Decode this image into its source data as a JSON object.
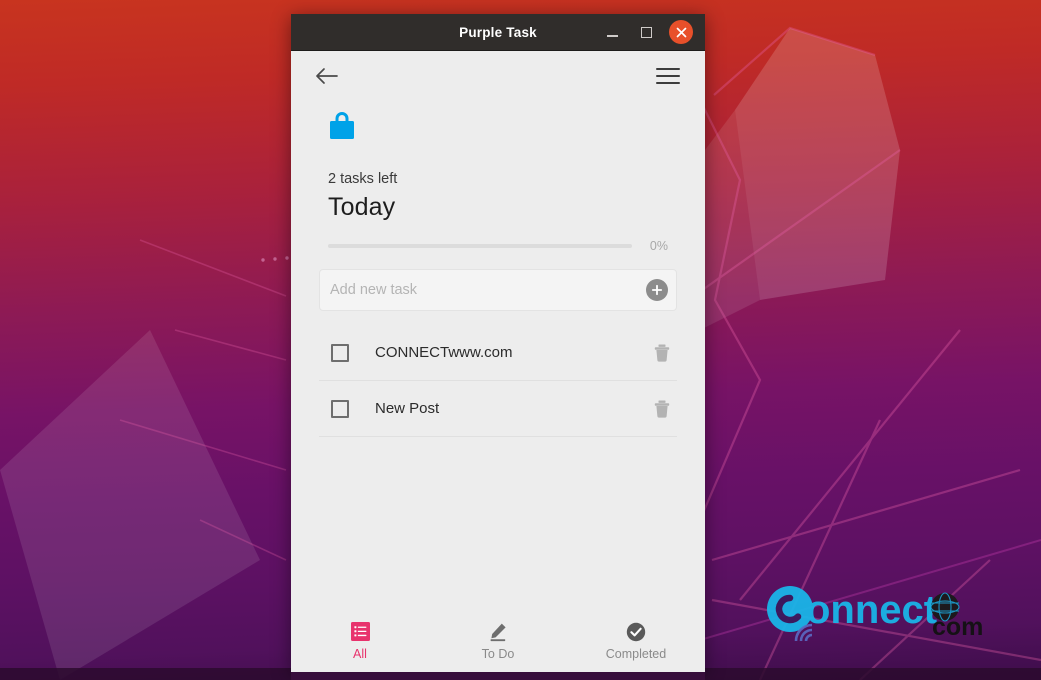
{
  "window": {
    "title": "Purple Task",
    "controls": {
      "minimize": "minimize-button",
      "maximize": "maximize-button",
      "close": "close-button"
    }
  },
  "toolbar": {
    "back_icon": "back-arrow-icon",
    "menu_icon": "hamburger-menu-icon"
  },
  "header": {
    "app_icon": "shopping-bag-icon",
    "tasks_left": "2 tasks left",
    "title": "Today"
  },
  "progress": {
    "percent": 0,
    "label": "0%"
  },
  "add_task": {
    "placeholder": "Add new task",
    "value": "",
    "button_icon": "plus-circle-icon"
  },
  "tasks": [
    {
      "label": "CONNECTwww.com",
      "checked": false,
      "delete_icon": "trash-icon"
    },
    {
      "label": "New Post",
      "checked": false,
      "delete_icon": "trash-icon"
    }
  ],
  "bottom_nav": [
    {
      "label": "All",
      "icon": "list-icon",
      "active": true
    },
    {
      "label": "To Do",
      "icon": "pencil-icon",
      "active": false
    },
    {
      "label": "Completed",
      "icon": "check-circle-icon",
      "active": false
    }
  ],
  "watermark": {
    "brand": "onnect",
    "suffix": "com",
    "initial": "C"
  },
  "colors": {
    "accent_pink": "#e8336d",
    "app_icon_blue": "#00a2e8",
    "close_orange": "#e8502a",
    "titlebar": "#302d2b",
    "app_background": "#ededed",
    "watermark_cyan": "#1ab5e8"
  }
}
